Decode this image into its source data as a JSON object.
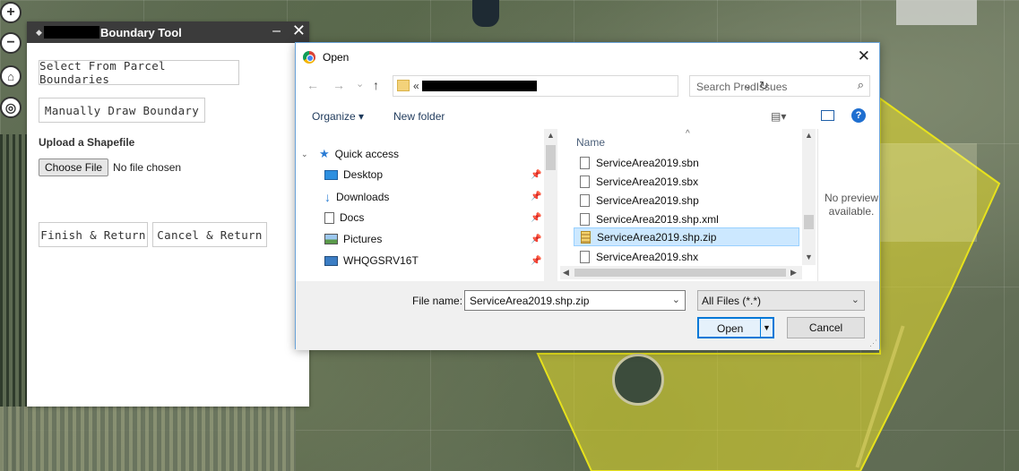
{
  "boundary_tool": {
    "title": "Boundary Tool",
    "minimize": "–",
    "close": "✕",
    "select_parcel_label": "Select From Parcel Boundaries",
    "draw_boundary_label": "Manually Draw Boundary",
    "upload_heading": "Upload a Shapefile",
    "choose_file_label": "Choose File",
    "no_file_text": "No file chosen",
    "finish_label": "Finish & Return",
    "cancel_label": "Cancel & Return"
  },
  "map_controls": {
    "zoom_in": "+",
    "zoom_out": "−",
    "home": "⌂",
    "locate": "◎"
  },
  "open_dialog": {
    "title": "Open",
    "close": "✕",
    "nav_back": "←",
    "nav_forward": "→",
    "nav_recent": "⌄",
    "nav_up": "↑",
    "address_prefix": "«",
    "address_dropdown": "⌄",
    "address_refresh": "↻",
    "search_placeholder": "Search ProdIssues",
    "search_icon": "⌕",
    "organize_label": "Organize ▾",
    "new_folder_label": "New folder",
    "view_icon": "▤▾",
    "help_icon": "?",
    "nav_items": [
      {
        "label": "Quick access",
        "icon": "star-icon"
      },
      {
        "label": "Desktop",
        "icon": "desktop-icon"
      },
      {
        "label": "Downloads",
        "icon": "download-icon"
      },
      {
        "label": "Docs",
        "icon": "document-icon"
      },
      {
        "label": "Pictures",
        "icon": "pictures-icon"
      },
      {
        "label": "WHQGSRV16T",
        "icon": "computer-icon"
      }
    ],
    "column_name": "Name",
    "files": [
      {
        "name": "ServiceArea2019.sbn",
        "type": "doc"
      },
      {
        "name": "ServiceArea2019.sbx",
        "type": "doc"
      },
      {
        "name": "ServiceArea2019.shp",
        "type": "doc"
      },
      {
        "name": "ServiceArea2019.shp.xml",
        "type": "doc"
      },
      {
        "name": "ServiceArea2019.shp.zip",
        "type": "zip",
        "selected": true
      },
      {
        "name": "ServiceArea2019.shx",
        "type": "doc"
      }
    ],
    "preview_text": "No preview available.",
    "file_name_label": "File name:",
    "file_name_value": "ServiceArea2019.shp.zip",
    "filter_value": "All Files (*.*)",
    "open_label": "Open",
    "cancel_label": "Cancel"
  }
}
